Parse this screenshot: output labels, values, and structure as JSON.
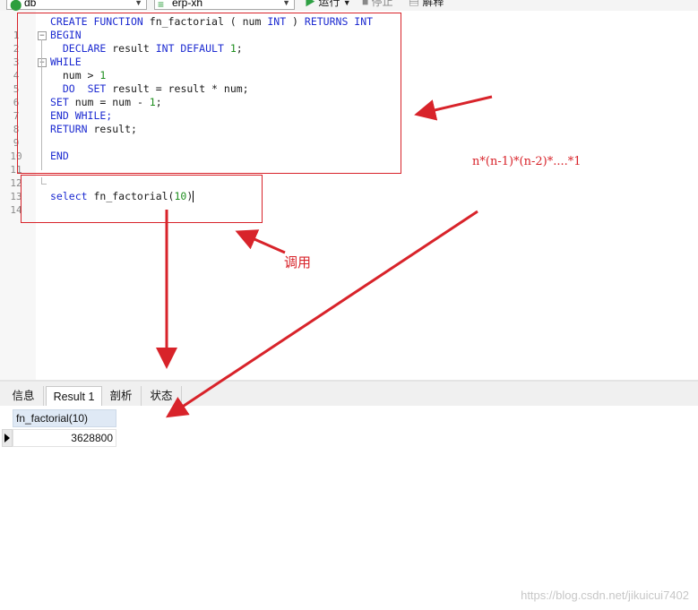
{
  "toolbar": {
    "connection": "db",
    "database": "erp-xh",
    "run_label": "运行",
    "stop_label": "停止",
    "explain_label": "解释"
  },
  "editor": {
    "lines": [
      {
        "n": "1",
        "fold": ""
      },
      {
        "n": "2",
        "fold": "−"
      },
      {
        "n": "3",
        "fold": ""
      },
      {
        "n": "4",
        "fold": "−"
      },
      {
        "n": "5",
        "fold": ""
      },
      {
        "n": "6",
        "fold": ""
      },
      {
        "n": "7",
        "fold": ""
      },
      {
        "n": "8",
        "fold": ""
      },
      {
        "n": "9",
        "fold": ""
      },
      {
        "n": "10",
        "fold": ""
      },
      {
        "n": "11",
        "fold": ""
      },
      {
        "n": "12",
        "fold": ""
      },
      {
        "n": "13",
        "fold": ""
      },
      {
        "n": "14",
        "fold": ""
      }
    ],
    "code": {
      "l1_kw1": "CREATE FUNCTION",
      "l1_name": " fn_factorial ( num ",
      "l1_kw2": "INT",
      "l1_mid": " ) ",
      "l1_kw3": "RETURNS INT",
      "l2": "BEGIN",
      "l3_kw1": "DECLARE",
      "l3_mid": " result ",
      "l3_kw2": "INT DEFAULT",
      "l3_num": "1",
      "l3_end": ";",
      "l4": "WHILE",
      "l5_mid": "num > ",
      "l5_num": "1",
      "l6_kw1": "DO",
      "l6_kw2": "SET",
      "l6_rest": " result = result * num;",
      "l7_kw": "SET",
      "l7_rest": " num = num - ",
      "l7_num": "1",
      "l7_end": ";",
      "l8": "END WHILE;",
      "l9_kw": "RETURN",
      "l9_rest": " result;",
      "l11": "END",
      "l14_kw": "select",
      "l14_rest": " fn_factorial(",
      "l14_num": "10",
      "l14_end": ")"
    }
  },
  "annotations": {
    "formula": "n*(n-1)*(n-2)*....*1",
    "call_label": "调用"
  },
  "tabs": [
    {
      "label": "信息",
      "active": false
    },
    {
      "label": "Result 1",
      "active": true
    },
    {
      "label": "剖析",
      "active": false
    },
    {
      "label": "状态",
      "active": false
    }
  ],
  "result": {
    "column": "fn_factorial(10)",
    "value": "3628800"
  },
  "watermark": "https://blog.csdn.net/jikuicui7402",
  "colors": {
    "annotation_red": "#d8232a",
    "keyword_blue": "#1d2bd1",
    "number_green": "#1e8e1e",
    "header_blue": "#dfe9f5"
  }
}
